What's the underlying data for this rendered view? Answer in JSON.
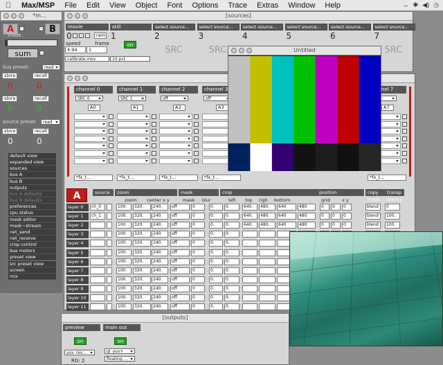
{
  "menubar": {
    "apple": "",
    "app": "Max/MSP",
    "items": [
      "File",
      "Edit",
      "View",
      "Object",
      "Font",
      "Options",
      "Trace",
      "Extras",
      "Window",
      "Help"
    ]
  },
  "left_panel": {
    "title": "*m...",
    "a": "A",
    "b": "B",
    "xfade": "xfade",
    "sum": "sum",
    "bus_preset": "bus preset",
    "read": "read",
    "store": "store",
    "recall": "recall",
    "zero": "0",
    "source_preset": "source preset",
    "menu": [
      "default view",
      "expanded view",
      "sources",
      "bus A",
      "bus B",
      "outputs",
      "bus A defaults",
      "bus B defaults",
      "preferences",
      "cpu status",
      "mask editor",
      "mask~stream",
      "net_send",
      "net_receive",
      "crop control",
      "bus motors",
      "preset view",
      "src preset view",
      "screen",
      "mix"
    ],
    "menu_dim": [
      6,
      7
    ]
  },
  "sources": {
    "title": "[sources]",
    "movie": "movie",
    "still": "still",
    "speed": "speed",
    "frame": "frame",
    "speed_val": "4.94",
    "frame_val": "1",
    "ram": "ram",
    "file": "calibrate.mov",
    "pct": "10 pct",
    "on": "on",
    "num0": "0",
    "num1": "1",
    "select": "select source...",
    "src": "SRC",
    "numbers": [
      "2",
      "3",
      "4",
      "5",
      "6",
      "7"
    ]
  },
  "untitled": {
    "title": "Untitled"
  },
  "channels": {
    "labels": [
      "channel 0",
      "channel 1",
      "channel 2",
      "channel 3",
      "channel 7"
    ],
    "sel": [
      "SRC 0",
      "SRC 1",
      "off",
      "off",
      "off"
    ],
    "sub": [
      "A0",
      "A1",
      "A2",
      "A3",
      "A7"
    ],
    "fx": "*fx_t..."
  },
  "layers": {
    "a": "A",
    "cols": [
      "source",
      "zoom",
      "mask",
      "crop",
      "position",
      "copy mode",
      "transp arency"
    ],
    "sub": [
      "zoom",
      "center x y",
      "mask",
      "blur",
      "left",
      "top",
      "righ",
      "bottom",
      "grid",
      "x y"
    ],
    "rows": [
      {
        "name": "layer 0",
        "src": "ch_0",
        "zoom": "100.",
        "cx": "320.",
        "cy": "240.",
        "mask": "off",
        "blur": "0",
        "l": "0.",
        "t": "0.",
        "r": "640.",
        "b": "480.",
        "r2": "640",
        "b2": "480",
        "g": "0",
        "x": "0",
        "y": "0",
        "mode": "blend",
        "tr": "0"
      },
      {
        "name": "layer 1",
        "src": "ch_1",
        "zoom": "100.",
        "cx": "320.",
        "cy": "240.",
        "mask": "off",
        "blur": "0",
        "l": "0.",
        "t": "0.",
        "r": "640.",
        "b": "480.",
        "r2": "640",
        "b2": "480",
        "g": "0",
        "x": "0",
        "y": "0",
        "mode": "blend",
        "tr": "100."
      },
      {
        "name": "layer 2",
        "src": "",
        "zoom": "100.",
        "cx": "320.",
        "cy": "240.",
        "mask": "off",
        "blur": "0",
        "l": "0.",
        "t": "0.",
        "r": "640.",
        "b": "480.",
        "r2": "640",
        "b2": "480",
        "g": "0",
        "x": "0",
        "y": "0",
        "mode": "blend",
        "tr": "100."
      },
      {
        "name": "layer 3",
        "src": "",
        "zoom": "100.",
        "cx": "320.",
        "cy": "240.",
        "mask": "off",
        "blur": "0",
        "l": "0.",
        "t": "0.",
        "r": "",
        "b": "",
        "r2": "",
        "b2": "",
        "g": "",
        "x": "",
        "y": "",
        "mode": "",
        "tr": ""
      },
      {
        "name": "layer 4",
        "src": "",
        "zoom": "100.",
        "cx": "320.",
        "cy": "240.",
        "mask": "off",
        "blur": "0",
        "l": "0.",
        "t": "0.",
        "r": "",
        "b": "",
        "r2": "",
        "b2": "",
        "g": "",
        "x": "",
        "y": "",
        "mode": "",
        "tr": ""
      },
      {
        "name": "layer 5",
        "src": "",
        "zoom": "100.",
        "cx": "320.",
        "cy": "240.",
        "mask": "off",
        "blur": "0",
        "l": "0.",
        "t": "0.",
        "r": "",
        "b": "",
        "r2": "",
        "b2": "",
        "g": "",
        "x": "",
        "y": "",
        "mode": "",
        "tr": ""
      },
      {
        "name": "layer 6",
        "src": "",
        "zoom": "100.",
        "cx": "320.",
        "cy": "240.",
        "mask": "off",
        "blur": "0",
        "l": "0.",
        "t": "0.",
        "r": "",
        "b": "",
        "r2": "",
        "b2": "",
        "g": "",
        "x": "",
        "y": "",
        "mode": "",
        "tr": ""
      },
      {
        "name": "layer 7",
        "src": "",
        "zoom": "100.",
        "cx": "320.",
        "cy": "240.",
        "mask": "off",
        "blur": "0",
        "l": "0.",
        "t": "0.",
        "r": "",
        "b": "",
        "r2": "",
        "b2": "",
        "g": "",
        "x": "",
        "y": "",
        "mode": "",
        "tr": ""
      },
      {
        "name": "layer 8",
        "src": "",
        "zoom": "100.",
        "cx": "320.",
        "cy": "240.",
        "mask": "off",
        "blur": "0",
        "l": "0.",
        "t": "0.",
        "r": "",
        "b": "",
        "r2": "",
        "b2": "",
        "g": "",
        "x": "",
        "y": "",
        "mode": "",
        "tr": ""
      },
      {
        "name": "layer 9",
        "src": "",
        "zoom": "100.",
        "cx": "320.",
        "cy": "240.",
        "mask": "off",
        "blur": "0",
        "l": "0.",
        "t": "0.",
        "r": "",
        "b": "",
        "r2": "",
        "b2": "",
        "g": "",
        "x": "",
        "y": "",
        "mode": "",
        "tr": ""
      },
      {
        "name": "layer 10",
        "src": "",
        "zoom": "100.",
        "cx": "320.",
        "cy": "240.",
        "mask": "off",
        "blur": "0",
        "l": "0.",
        "t": "0.",
        "r": "",
        "b": "",
        "r2": "",
        "b2": "",
        "g": "",
        "x": "",
        "y": "",
        "mode": "",
        "tr": ""
      },
      {
        "name": "layer 11",
        "src": "",
        "zoom": "100.",
        "cx": "320.",
        "cy": "240.",
        "mask": "off",
        "blur": "0",
        "l": "0.",
        "t": "0.",
        "r": "",
        "b": "",
        "r2": "",
        "b2": "",
        "g": "",
        "x": "",
        "y": "",
        "mode": "",
        "tr": ""
      }
    ]
  },
  "outputs": {
    "title": "[outputs]",
    "preview": "preview",
    "main_out": "main out",
    "on": "on",
    "yuv": "yuv_rev...",
    "gl": "gl_yuv+",
    "floating": "floating ...",
    "rd": "RD: 2"
  },
  "colors": {
    "bars_top": [
      "#c0c0c0",
      "#c0c000",
      "#00c0c0",
      "#00c000",
      "#c000c0",
      "#c00000",
      "#0000c0"
    ],
    "bars_bottom": [
      "#00215c",
      "#ffffff",
      "#330072",
      "#131313",
      "#1d1d1d",
      "#111111",
      "#262626"
    ],
    "accent_red": "#cc1111",
    "green": "#24a024"
  }
}
